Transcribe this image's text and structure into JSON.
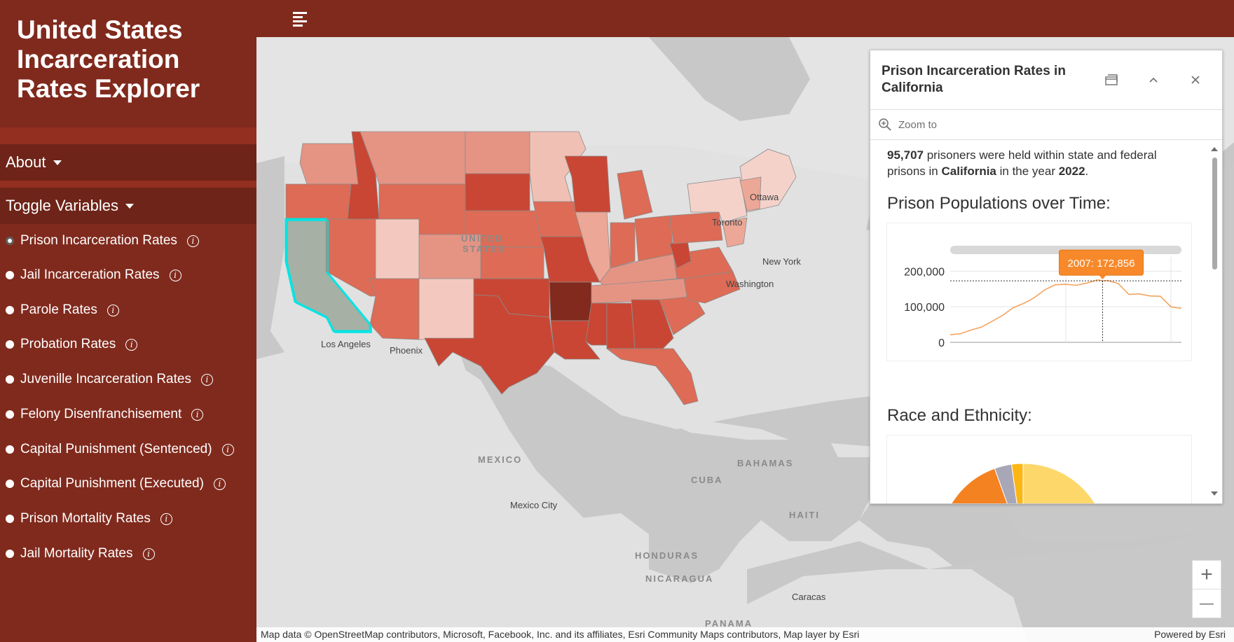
{
  "app": {
    "title": "United States Incarceration Rates Explorer"
  },
  "sidebar": {
    "about_label": "About",
    "toggle_label": "Toggle Variables",
    "variables": [
      {
        "label": "Prison Incarceration Rates",
        "selected": true
      },
      {
        "label": "Jail Incarceration Rates",
        "selected": false
      },
      {
        "label": "Parole Rates",
        "selected": false
      },
      {
        "label": "Probation Rates",
        "selected": false
      },
      {
        "label": "Juvenille Incarceration Rates",
        "selected": false
      },
      {
        "label": "Felony Disenfranchisement",
        "selected": false
      },
      {
        "label": "Capital Punishment (Sentenced)",
        "selected": false
      },
      {
        "label": "Capital Punishment (Executed)",
        "selected": false
      },
      {
        "label": "Prison Mortality Rates",
        "selected": false
      },
      {
        "label": "Jail Mortality Rates",
        "selected": false
      }
    ],
    "info_icon": "info-icon"
  },
  "map": {
    "country_labels": [
      "UNITED",
      "STATES",
      "MEXICO",
      "CUBA",
      "BAHAMAS",
      "HAITI",
      "HONDURAS",
      "NICARAGUA",
      "PANAMA"
    ],
    "city_labels": [
      "Ottawa",
      "Toronto",
      "New York",
      "Washington",
      "Los Angeles",
      "Phoenix",
      "Mexico City",
      "Caracas"
    ],
    "attribution": "Map data © OpenStreetMap contributors, Microsoft, Facebook, Inc. and its affiliates, Esri Community Maps contributors, Map layer by Esri",
    "powered_by": "Powered by Esri",
    "zoom_in": "+",
    "zoom_out": "—",
    "colors": {
      "land": "#e1e1e1",
      "water": "#c8c8c8",
      "highlight": "#00e5e5",
      "selected_fill": "#a6b0a4"
    }
  },
  "popup": {
    "title": "Prison Incarceration Rates in California",
    "zoom_to": "Zoom to",
    "summary": {
      "count": "95,707",
      "text1": " prisoners were held within state and federal prisons in ",
      "state": "California",
      "text2": " in the year ",
      "year": "2022",
      "end": "."
    },
    "section1_title": "Prison Populations over Time:",
    "section2_title": "Race and Ethnicity:",
    "tooltip": "2007: 172,856",
    "icons": [
      "dock-icon",
      "collapse-icon",
      "close-icon"
    ]
  },
  "chart_data": [
    {
      "type": "line",
      "title": "Prison Populations over Time:",
      "x": [
        1978,
        1980,
        1982,
        1984,
        1986,
        1988,
        1990,
        1992,
        1994,
        1996,
        1998,
        2000,
        2002,
        2004,
        2006,
        2007,
        2008,
        2010,
        2011,
        2012,
        2014,
        2016,
        2018,
        2020,
        2021,
        2022
      ],
      "series": [
        {
          "values": [
            21325,
            24569,
            34640,
            43328,
            59484,
            76171,
            97309,
            109496,
            125605,
            147712,
            161904,
            163001,
            160315,
            166556,
            175512,
            172856,
            173670,
            165062,
            149569,
            134534,
            136088,
            130390,
            129417,
            99929,
            97328,
            95707
          ]
        }
      ],
      "yticks": [
        "0",
        "100,000",
        "200,000"
      ],
      "ylim": [
        0,
        240000
      ],
      "grid": true,
      "highlight": {
        "x": 2007,
        "label": "2007: 172,856"
      },
      "color": "#f4a460"
    },
    {
      "type": "pie",
      "title": "Race and Ethnicity:",
      "values": [
        44,
        10,
        32,
        3,
        2
      ],
      "colors": [
        "#fdd76a",
        "#6da84e",
        "#f58220",
        "#a7a7b8",
        "#fbb614"
      ]
    }
  ]
}
